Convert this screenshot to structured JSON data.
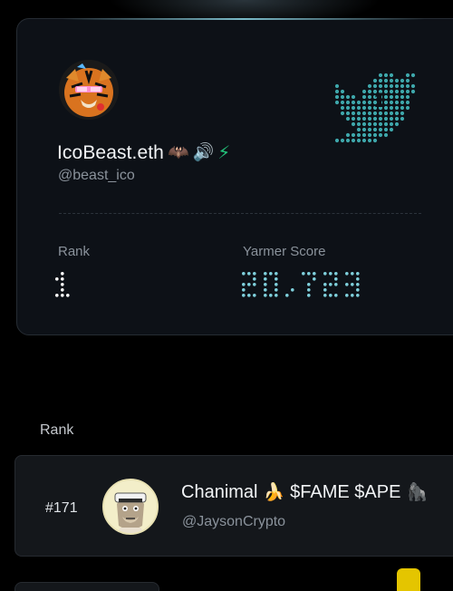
{
  "profile": {
    "name": "IcoBeast.eth",
    "emojis": [
      "🦇",
      "🔊"
    ],
    "bolt": "⚡",
    "handle": "@beast_ico",
    "twitter_rank": "1",
    "stats": {
      "rank_label": "Rank",
      "rank_value": "1",
      "score_label": "Yarmer Score",
      "score_value": "20,723"
    }
  },
  "rank_section": {
    "heading": "Rank",
    "rows": [
      {
        "rank": "#171",
        "name": "Chanimal",
        "emoji": "🍌",
        "tags": "$FAME $APE",
        "trailing_emoji": "🦍",
        "handle": "@JaysonCrypto"
      }
    ]
  },
  "colors": {
    "background": "#000000",
    "card": "#0d1117",
    "dot_matrix": "#7fd0dc",
    "twitter_bird": "#3ea7ab",
    "bolt": "#23c27a",
    "muted_text": "#8a929b"
  },
  "icons": [
    "tiger-avatar-icon",
    "twitter-bird-icon",
    "bat-icon",
    "speaker-icon",
    "lightning-icon",
    "banana-icon",
    "gorilla-icon",
    "ape-avatar-icon"
  ]
}
